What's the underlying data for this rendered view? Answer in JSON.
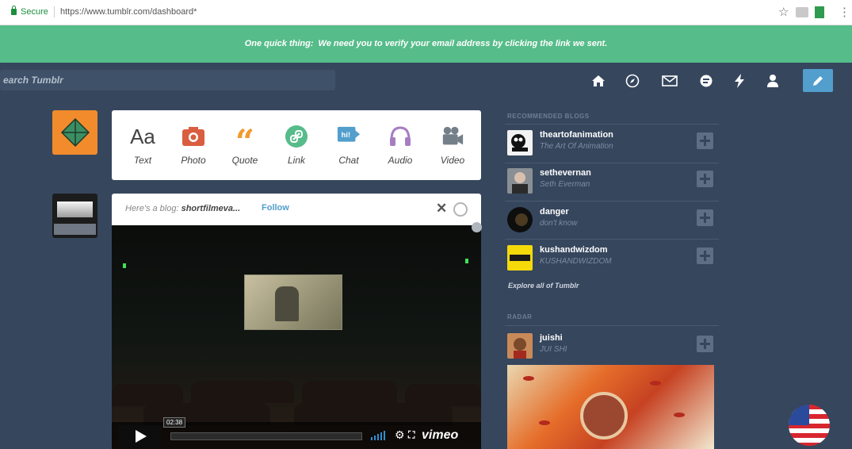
{
  "browser": {
    "secure_label": "Secure",
    "url": "https://www.tumblr.com/dashboard*"
  },
  "banner": {
    "bold_text": "One quick thing:",
    "text": "We need you to verify your email address by clicking the link we sent."
  },
  "nav": {
    "search_placeholder": "earch Tumblr",
    "icons": [
      "home-icon",
      "explore-icon",
      "inbox-icon",
      "messaging-icon",
      "activity-icon",
      "account-icon",
      "compose-icon"
    ]
  },
  "post_types": [
    {
      "label": "Text",
      "icon": "text-icon",
      "color": "#444444"
    },
    {
      "label": "Photo",
      "icon": "camera-icon",
      "color": "#d95e40"
    },
    {
      "label": "Quote",
      "icon": "quote-icon",
      "color": "#f2992e"
    },
    {
      "label": "Link",
      "icon": "link-icon",
      "color": "#56bc8a"
    },
    {
      "label": "Chat",
      "icon": "chat-icon",
      "color": "#529ecc"
    },
    {
      "label": "Audio",
      "icon": "headphones-icon",
      "color": "#a77dc2"
    },
    {
      "label": "Video",
      "icon": "video-camera-icon",
      "color": "#748089"
    }
  ],
  "recommended_post": {
    "intro": "Here's a blog:",
    "blog_name": "shortfilmeva...",
    "follow_label": "Follow",
    "video": {
      "time": "02:38",
      "brand": "vimeo"
    }
  },
  "sidebar": {
    "recommended_heading": "RECOMMENDED BLOGS",
    "blogs": [
      {
        "name": "theartofanimation",
        "subtitle": "The Art Of Animation"
      },
      {
        "name": "sethevernan",
        "subtitle": "Seth Everman"
      },
      {
        "name": "danger",
        "subtitle": "don't know"
      },
      {
        "name": "kushandwizdom",
        "subtitle": "KUSHANDWIZDOM"
      }
    ],
    "explore_label": "Explore all of Tumblr",
    "radar_heading": "RADAR",
    "radar_post": {
      "name": "juishi",
      "subtitle": "JUI SHI"
    }
  },
  "colors": {
    "background": "#36465d",
    "banner": "#56bc8a",
    "accent": "#529ecc",
    "avatar_orange": "#f28b2c"
  }
}
